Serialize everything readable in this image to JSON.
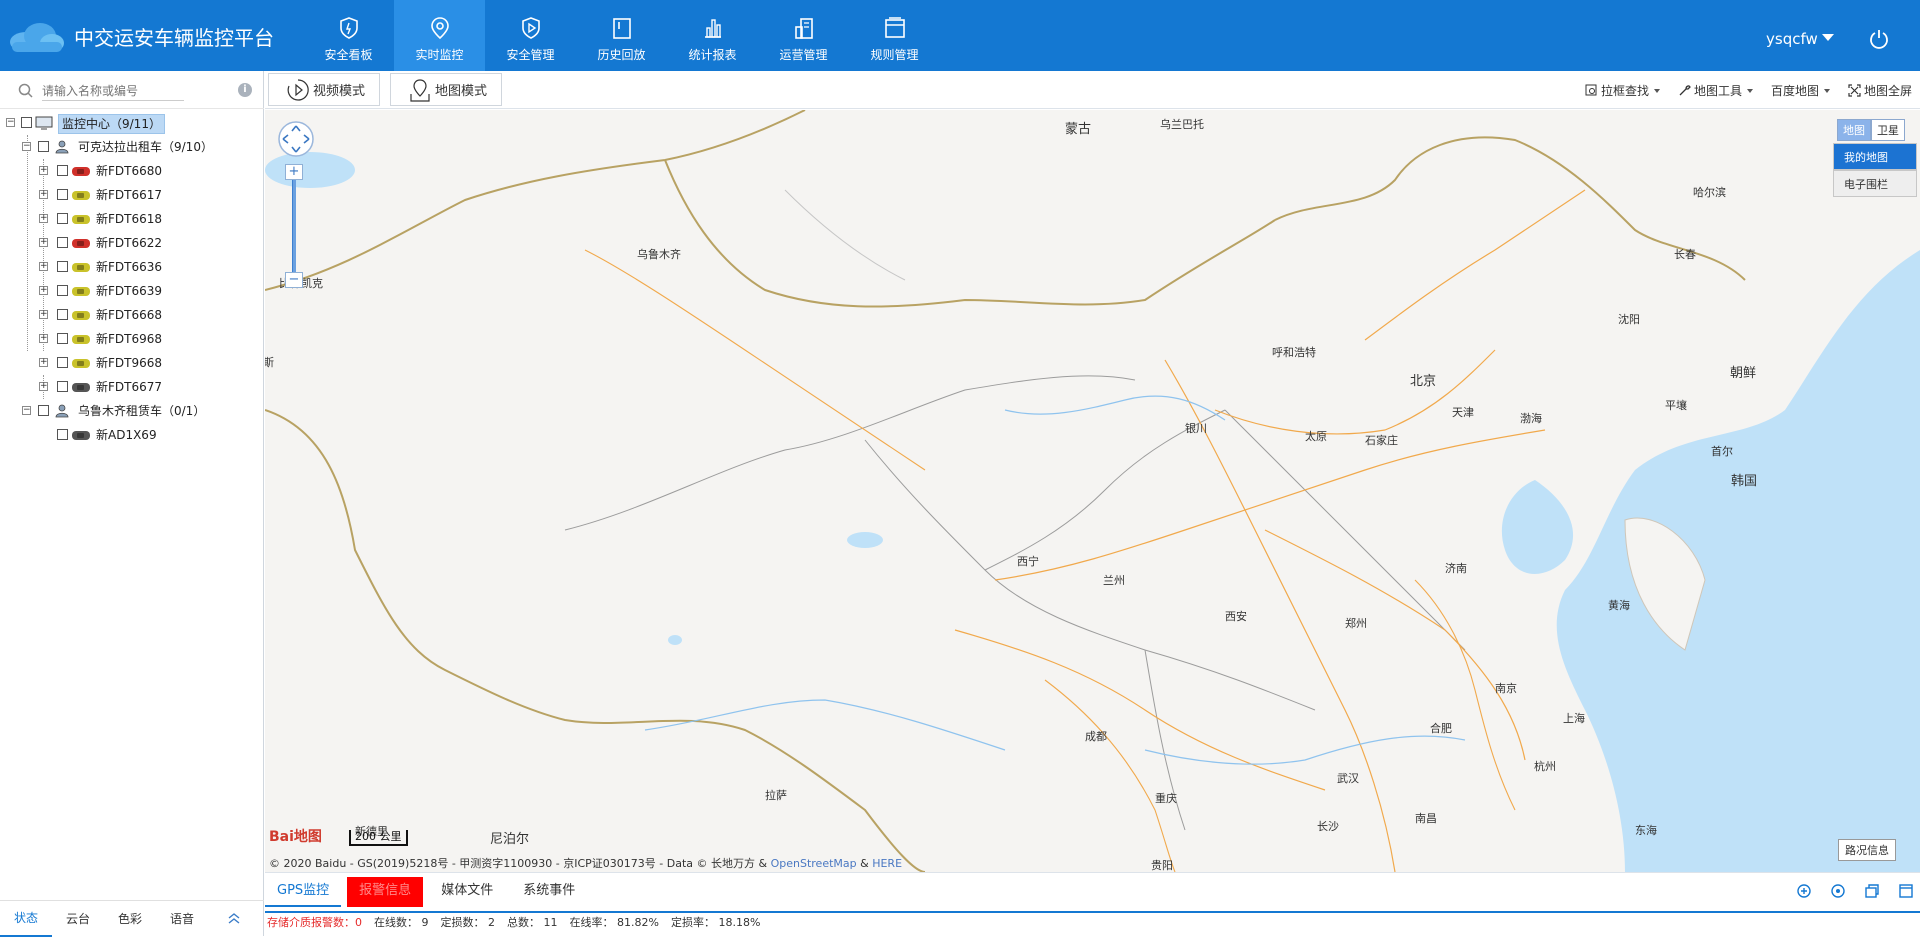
{
  "header": {
    "title": "中交运安车辆监控平台",
    "nav": [
      {
        "label": "安全看板",
        "icon": "shield-icon"
      },
      {
        "label": "实时监控",
        "icon": "location-pin-icon",
        "active": true
      },
      {
        "label": "安全管理",
        "icon": "play-shield-icon"
      },
      {
        "label": "历史回放",
        "icon": "history-icon"
      },
      {
        "label": "统计报表",
        "icon": "bar-chart-icon"
      },
      {
        "label": "运营管理",
        "icon": "building-icon"
      },
      {
        "label": "规则管理",
        "icon": "window-icon"
      }
    ],
    "username": "ysqcfw"
  },
  "sidebar": {
    "search_placeholder": "请输入名称或编号",
    "root": {
      "label": "监控中心（9/11）"
    },
    "groups": [
      {
        "label": "可克达拉出租车（9/10）"
      },
      {
        "label": "乌鲁木齐租赁车（0/1）"
      }
    ],
    "vehicles": [
      {
        "label": "新FDT6680",
        "color": "#d0302a"
      },
      {
        "label": "新FDT6617",
        "color": "#c9c22a"
      },
      {
        "label": "新FDT6618",
        "color": "#c9c22a"
      },
      {
        "label": "新FDT6622",
        "color": "#d0302a"
      },
      {
        "label": "新FDT6636",
        "color": "#c9c22a"
      },
      {
        "label": "新FDT6639",
        "color": "#c9c22a"
      },
      {
        "label": "新FDT6668",
        "color": "#c9c22a"
      },
      {
        "label": "新FDT6968",
        "color": "#c9c22a"
      },
      {
        "label": "新FDT9668",
        "color": "#c9c22a"
      },
      {
        "label": "新FDT6677",
        "color": "#555555"
      },
      {
        "label": "新AD1X69",
        "color": "#555555"
      }
    ],
    "tabs": [
      "状态",
      "云台",
      "色彩",
      "语音"
    ]
  },
  "toolbar": {
    "video_mode": "视频模式",
    "map_mode": "地图模式",
    "tools": [
      "拉框查找",
      "地图工具",
      "百度地图",
      "地图全屏"
    ]
  },
  "map": {
    "maptypes": [
      "地图",
      "卫星"
    ],
    "menu": [
      "我的地图",
      "电子围栏"
    ],
    "cities": [
      {
        "name": "蒙古",
        "big": true
      },
      {
        "name": "乌兰巴托"
      },
      {
        "name": "哈尔滨"
      },
      {
        "name": "长春"
      },
      {
        "name": "乌鲁木齐"
      },
      {
        "name": "比什凯克"
      },
      {
        "name": "沈阳"
      },
      {
        "name": "呼和浩特"
      },
      {
        "name": "北京",
        "big": true
      },
      {
        "name": "朝鲜",
        "big": true
      },
      {
        "name": "天津"
      },
      {
        "name": "平壤"
      },
      {
        "name": "渤海"
      },
      {
        "name": "银川"
      },
      {
        "name": "太原"
      },
      {
        "name": "石家庄"
      },
      {
        "name": "首尔"
      },
      {
        "name": "韩国",
        "big": true
      },
      {
        "name": "西宁"
      },
      {
        "name": "济南"
      },
      {
        "name": "兰州"
      },
      {
        "name": "黄海"
      },
      {
        "name": "西安"
      },
      {
        "name": "郑州"
      },
      {
        "name": "南京"
      },
      {
        "name": "合肥"
      },
      {
        "name": "上海"
      },
      {
        "name": "成都"
      },
      {
        "name": "武汉"
      },
      {
        "name": "拉萨"
      },
      {
        "name": "重庆"
      },
      {
        "name": "杭州"
      },
      {
        "name": "新德里"
      },
      {
        "name": "尼泊尔",
        "big": true
      },
      {
        "name": "长沙"
      },
      {
        "name": "南昌"
      },
      {
        "name": "东海"
      },
      {
        "name": "贵阳"
      },
      {
        "name": "斯"
      }
    ],
    "logo": "Bai地图",
    "scale": "200 公里",
    "copyright_prefix": "© 2020 Baidu - GS(2019)5218号 - 甲测资字1100930 - 京ICP证030173号 - Data © 长地万方 &",
    "copyright_link1": "OpenStreetMap",
    "copyright_amp": "&",
    "copyright_link2": "HERE",
    "traffic": "路况信息"
  },
  "bottom": {
    "tabs": [
      "GPS监控",
      "报警信息",
      "媒体文件",
      "系统事件"
    ],
    "status": {
      "storage_label": "存储介质报警数：",
      "storage_value": "0",
      "online": "在线数：  9",
      "located": "定损数：  2",
      "total": "总数：  11",
      "online_rate": "在线率：  81.82%",
      "located_rate": "定损率：  18.18%"
    }
  },
  "colors": {
    "topbar": "#1478d2",
    "nav_active": "#2a8fe6",
    "alarm_tab": "#ff0000"
  }
}
